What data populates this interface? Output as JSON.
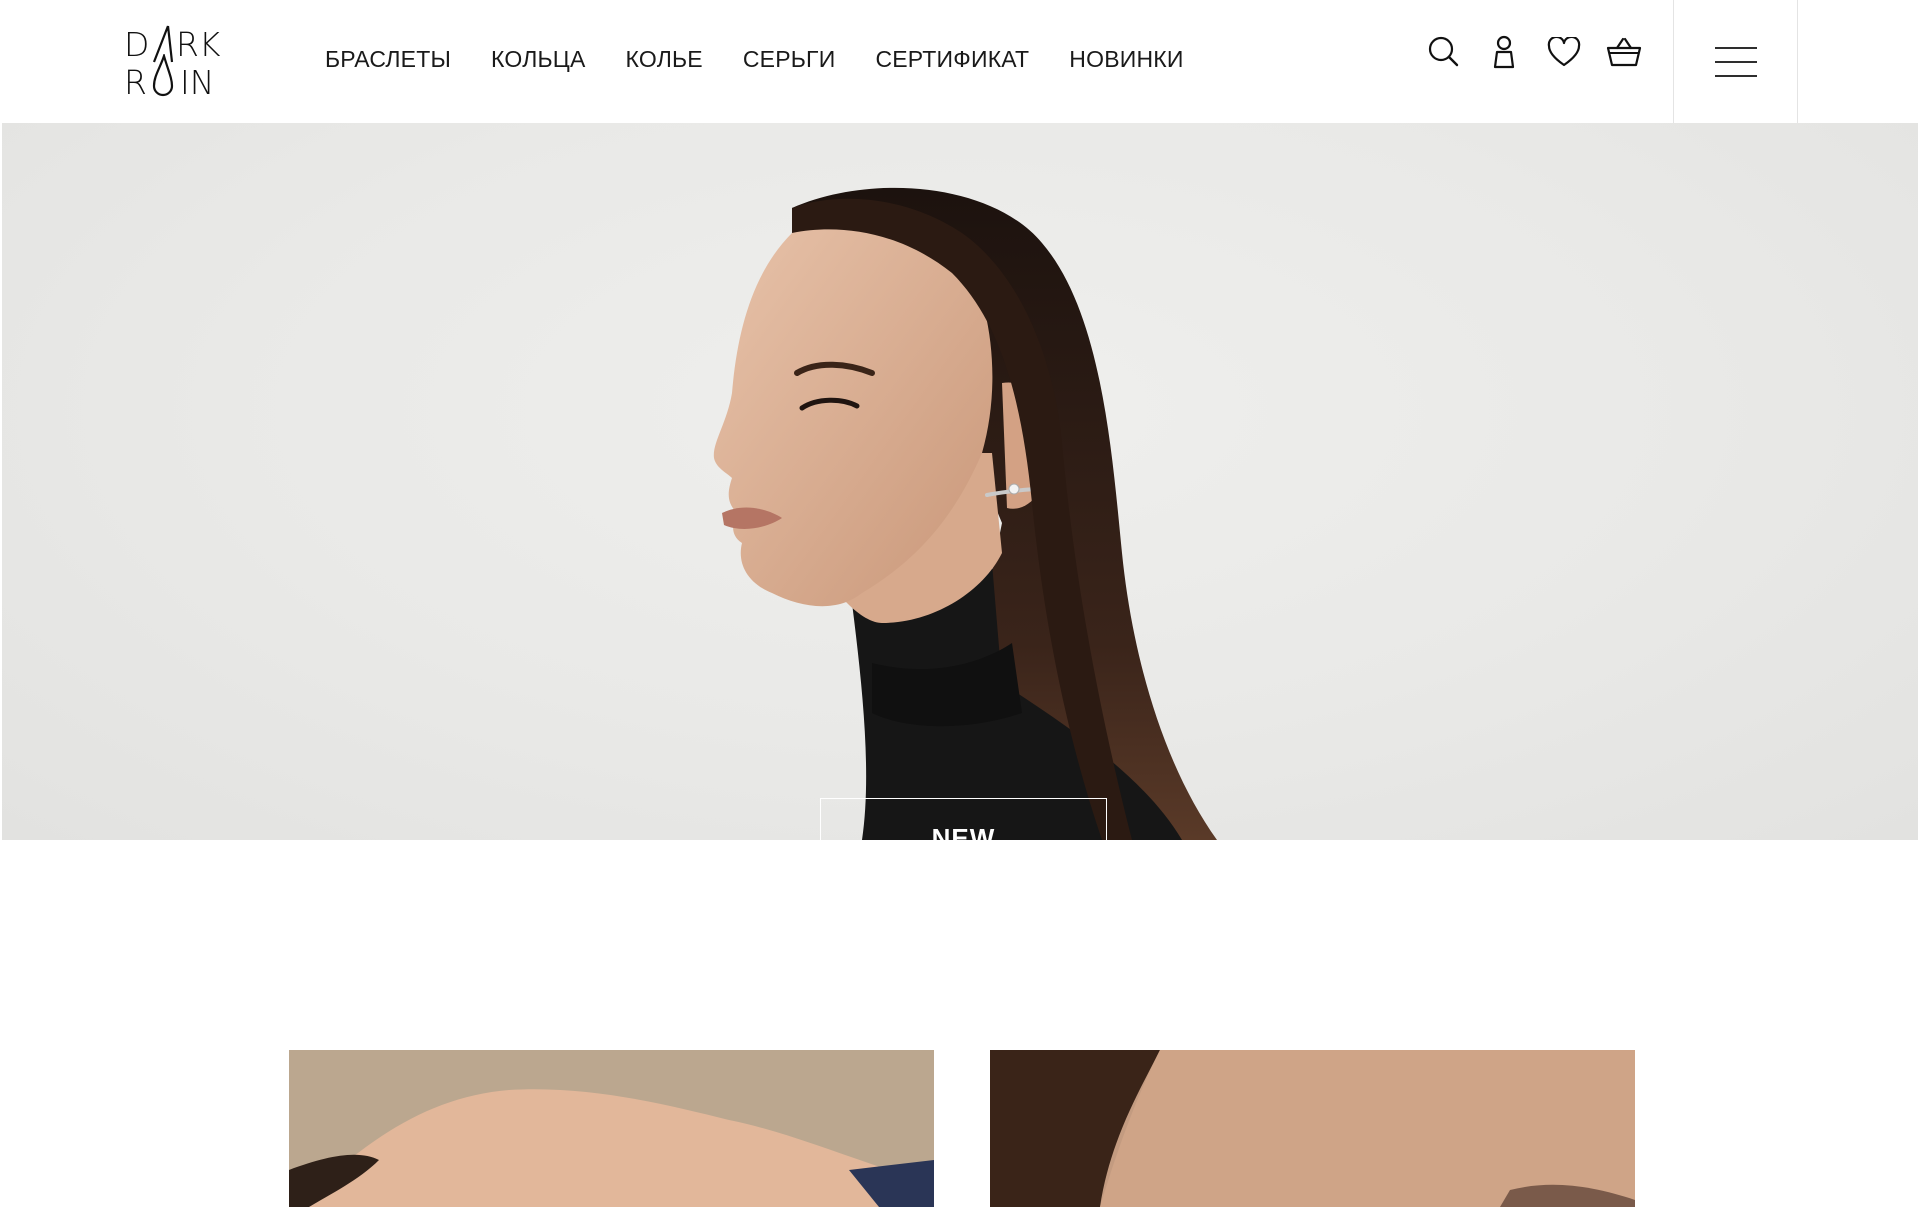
{
  "brand": {
    "logo_top": "D RK",
    "logo_bottom": "R IN"
  },
  "nav": {
    "items": [
      {
        "label": "БРАСЛЕТЫ"
      },
      {
        "label": "КОЛЬЦА"
      },
      {
        "label": "КОЛЬЕ"
      },
      {
        "label": "СЕРЬГИ"
      },
      {
        "label": "СЕРТИФИКАТ"
      },
      {
        "label": "НОВИНКИ"
      }
    ]
  },
  "header_icons": [
    "search-icon",
    "user-icon",
    "heart-icon",
    "basket-icon",
    "hamburger-menu-icon"
  ],
  "hero": {
    "button_label": "NEW"
  },
  "colors": {
    "text": "#111111",
    "hero_bg": "#ebebe9",
    "tile_left": "#bba78f",
    "tile_right": "#c39b80",
    "button_border": "#ffffff"
  }
}
